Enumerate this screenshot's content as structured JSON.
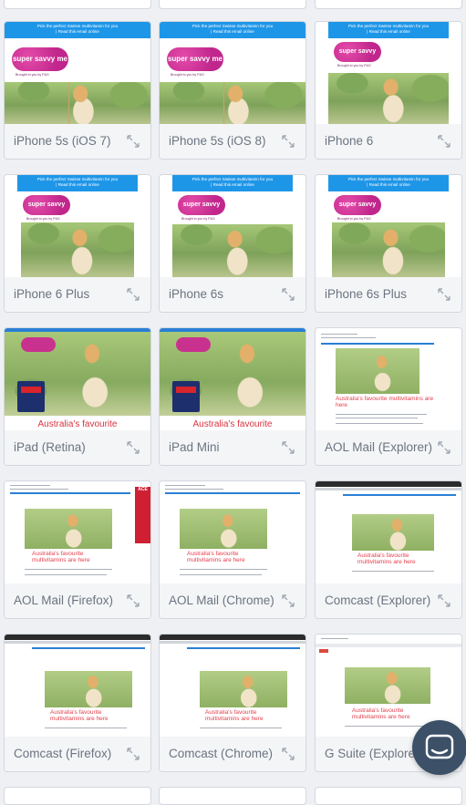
{
  "email": {
    "banner_line1": "Pick the perfect Swisse multivitamin for you",
    "banner_line2": "| Read this email online",
    "logo_text": "super savvy me",
    "logo_sub": "Brought to you by P&G",
    "headline_short": "Australia's favourite",
    "headline_full": "Australia's favourite multivitamins are here",
    "ace_text": "ACE"
  },
  "devices": [
    {
      "label": "iPhone 5s (iOS 7)"
    },
    {
      "label": "iPhone 5s (iOS 8)"
    },
    {
      "label": "iPhone 6"
    },
    {
      "label": "iPhone 6 Plus"
    },
    {
      "label": "iPhone 6s"
    },
    {
      "label": "iPhone 6s Plus"
    },
    {
      "label": "iPad (Retina)"
    },
    {
      "label": "iPad Mini"
    },
    {
      "label": "AOL Mail (Explorer)"
    },
    {
      "label": "AOL Mail (Firefox)"
    },
    {
      "label": "AOL Mail (Chrome)"
    },
    {
      "label": "Comcast (Explorer)"
    },
    {
      "label": "Comcast (Firefox)"
    },
    {
      "label": "Comcast (Chrome)"
    },
    {
      "label": "G Suite (Explorer)"
    }
  ],
  "icons": {
    "expand": "expand-icon",
    "chat": "chat-icon"
  },
  "colors": {
    "banner": "#1e96e8",
    "brand_pink": "#c9318f",
    "headline_red": "#e3404e",
    "chat_bg": "#3c5067"
  }
}
